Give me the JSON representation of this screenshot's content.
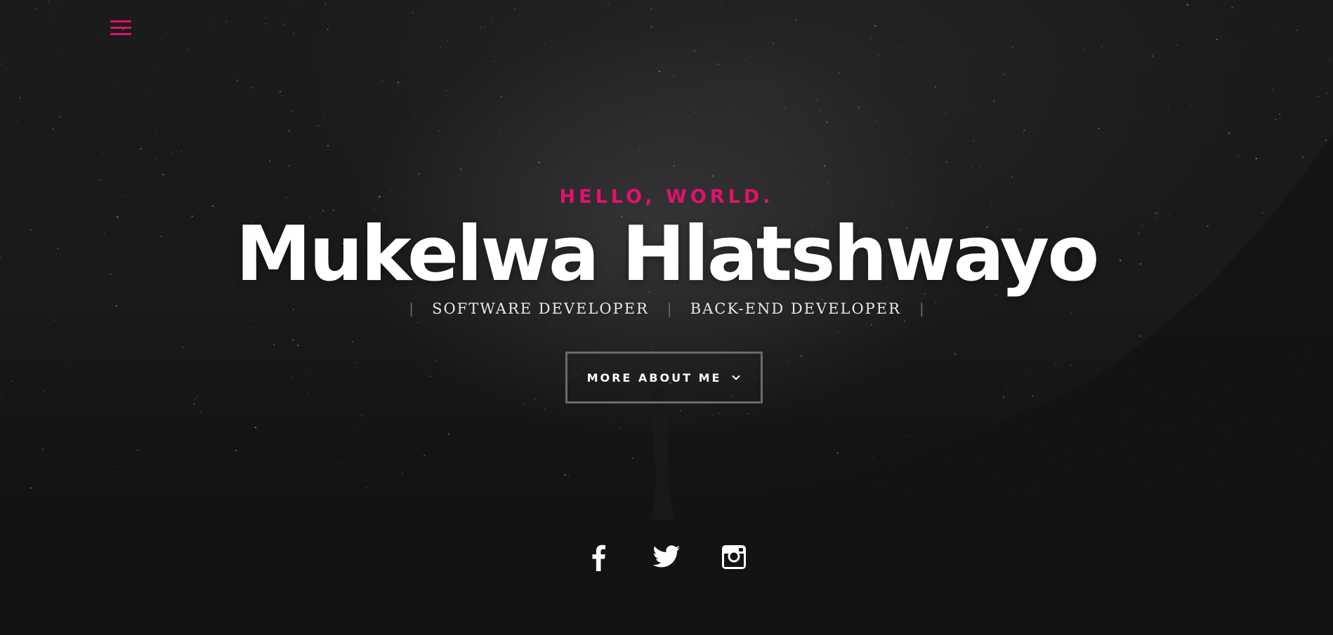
{
  "header": {
    "menu_icon": "hamburger-menu-icon"
  },
  "hero": {
    "greeting": "HELLO, WORLD.",
    "name": "Mukelwa Hlatshwayo",
    "roles": [
      "SOFTWARE DEVELOPER",
      "BACK-END DEVELOPER"
    ],
    "role_separator": "|",
    "cta_label": "MORE ABOUT ME",
    "cta_icon": "chevron-down-icon"
  },
  "social": [
    {
      "name": "facebook",
      "icon": "facebook-icon"
    },
    {
      "name": "twitter",
      "icon": "twitter-icon"
    },
    {
      "name": "instagram",
      "icon": "instagram-icon"
    }
  ],
  "colors": {
    "accent": "#e3116c",
    "background": "#111112",
    "text": "#ffffff",
    "button_border": "#6b6b6d"
  }
}
